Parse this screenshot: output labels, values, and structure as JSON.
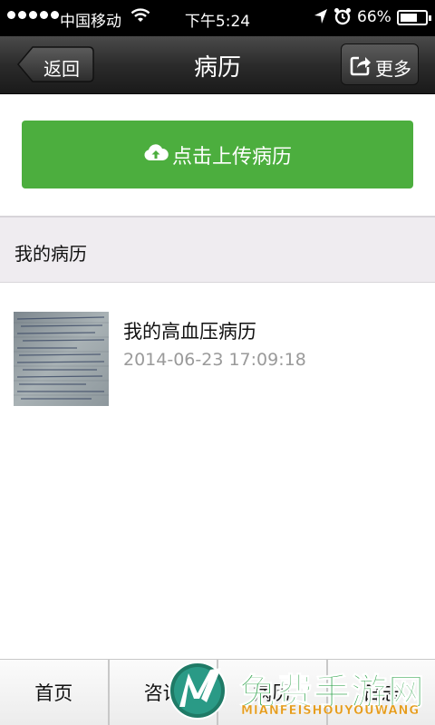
{
  "status_bar": {
    "carrier": "中国移动",
    "time": "下午5:24",
    "battery_text": "66%",
    "battery_level": 0.66
  },
  "nav": {
    "back_label": "返回",
    "title": "病历",
    "more_label": "更多"
  },
  "upload": {
    "label": "点击上传病历",
    "icon": "cloud-upload-icon",
    "color": "#4cae3e"
  },
  "section": {
    "title": "我的病历"
  },
  "records": [
    {
      "title": "我的高血压病历",
      "time": "2014-06-23 17:09:18"
    }
  ],
  "tabs": [
    {
      "label": "首页"
    },
    {
      "label": "咨询"
    },
    {
      "label": "病历"
    },
    {
      "label": "日志"
    }
  ],
  "watermark": {
    "text": "免费手游网",
    "subtext": "MIANFEISHOUYOUWANG"
  }
}
